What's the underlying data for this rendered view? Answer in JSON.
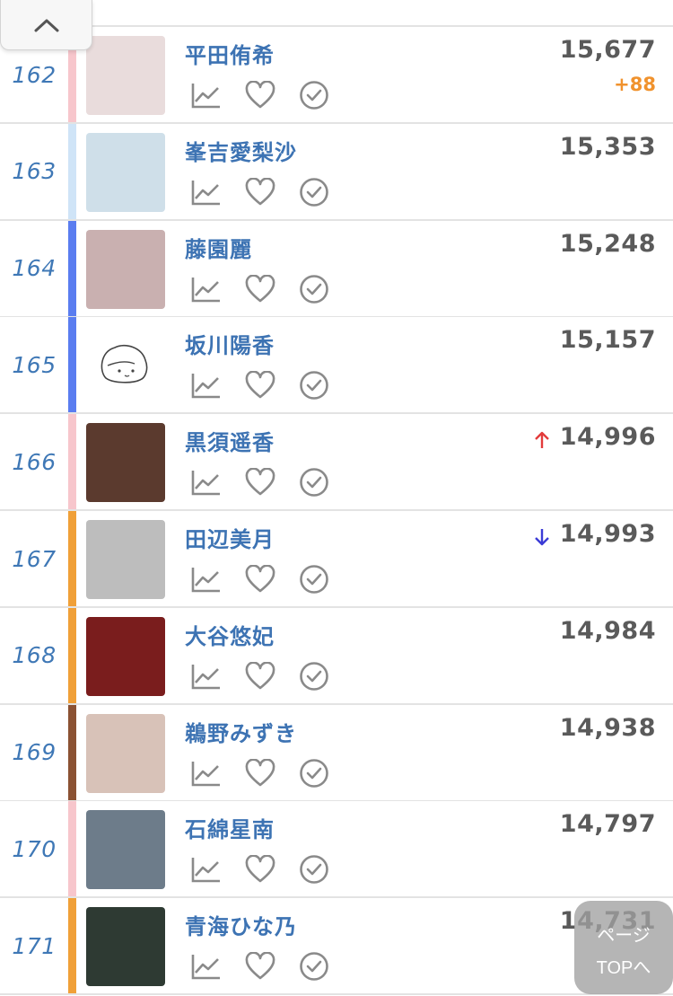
{
  "collapse_button": {
    "icon": "chevron-up-icon"
  },
  "rows": [
    {
      "rank": "162",
      "name": "平田侑希",
      "score": "15,677",
      "delta": "+88",
      "trend": "",
      "color": "#f7c6cc"
    },
    {
      "rank": "163",
      "name": "峯吉愛梨沙",
      "score": "15,353",
      "delta": "",
      "trend": "",
      "color": "#cfe4f7"
    },
    {
      "rank": "164",
      "name": "藤園麗",
      "score": "15,248",
      "delta": "",
      "trend": "",
      "color": "#5a7df0"
    },
    {
      "rank": "165",
      "name": "坂川陽香",
      "score": "15,157",
      "delta": "",
      "trend": "",
      "color": "#5a7df0"
    },
    {
      "rank": "166",
      "name": "黒須遥香",
      "score": "14,996",
      "delta": "",
      "trend": "up",
      "color": "#f7c6cc"
    },
    {
      "rank": "167",
      "name": "田辺美月",
      "score": "14,993",
      "delta": "",
      "trend": "down",
      "color": "#f0a038"
    },
    {
      "rank": "168",
      "name": "大谷悠妃",
      "score": "14,984",
      "delta": "",
      "trend": "",
      "color": "#f0a038"
    },
    {
      "rank": "169",
      "name": "鵜野みずき",
      "score": "14,938",
      "delta": "",
      "trend": "",
      "color": "#8b5233"
    },
    {
      "rank": "170",
      "name": "石綿星南",
      "score": "14,797",
      "delta": "",
      "trend": "",
      "color": "#f7c6cc"
    },
    {
      "rank": "171",
      "name": "青海ひな乃",
      "score": "14,731",
      "delta": "",
      "trend": "",
      "color": "#f0a038"
    }
  ],
  "page_top_button": {
    "line1": "ページ",
    "line2": "TOPへ"
  },
  "colors": {
    "rank_blue": "#3f78b6",
    "name_blue": "#3d73b3",
    "delta_orange": "#f0922d",
    "trend_up": "#e23b3b",
    "trend_down": "#3b3bd6",
    "icon_gray": "#8a8a8a"
  }
}
